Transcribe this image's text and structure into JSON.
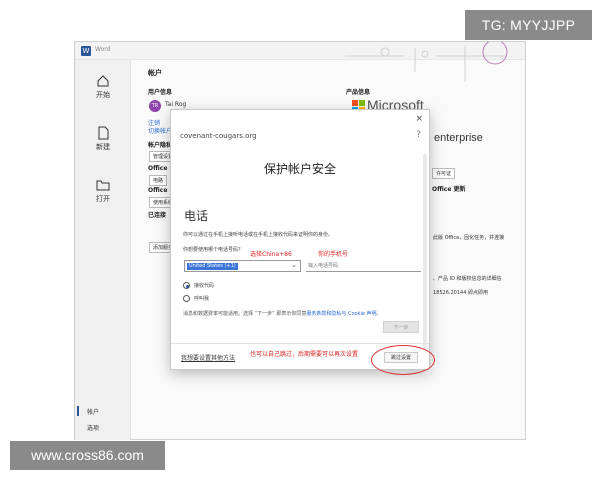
{
  "watermarks": {
    "top": "TG: MYYJJPP",
    "bottom": "www.cross86.com"
  },
  "app": {
    "title": "Word",
    "nav": [
      {
        "label": "开始",
        "icon": "home-icon"
      },
      {
        "label": "新建",
        "icon": "new-document-icon"
      },
      {
        "label": "打开",
        "icon": "folder-icon"
      }
    ],
    "bottom_nav": [
      "帐户",
      "选项"
    ],
    "page_title": "帐户",
    "user_info_heading": "用户信息",
    "user_name": "Tai Rog",
    "avatar_initials": "TR",
    "sign_out": "注销",
    "switch_account": "切换帐户",
    "account_privacy_heading": "帐户隐私",
    "manage_settings": "管理设置",
    "office_bg": "Office",
    "bg_value_1": "电路",
    "office_theme": "Office",
    "bg_value_2": "使用系统",
    "connected_services": "已连接",
    "add_service": "添加服务",
    "product_info_heading": "产品信息",
    "brand": "Microsoft",
    "enterprise": "enterprise",
    "license": "许可证",
    "office_update": "Office 更新",
    "product_text_1": "此版 Office，固化任务，并连接",
    "product_text_2": "、产品 ID 和版权信息的详细信",
    "product_text_3": "18526.20144 即点即用"
  },
  "dialog": {
    "close": "×",
    "domain": "covenant-cougars.org",
    "help": "?",
    "heading": "保护帐户安全",
    "section_title": "电话",
    "description": "你可以通过在手机上接听电话或在手机上接收代码来证明你的身份。",
    "question": "你想要使用哪个电话号码？",
    "country_value": "United States (+1)",
    "phone_placeholder": "输入电话号码",
    "radio_options": [
      {
        "label": "接收代码",
        "selected": true
      },
      {
        "label": "呼叫我",
        "selected": false
      }
    ],
    "fine_print_pre": "消息和数据费率可能适用。选择 “下一步” 即表示你同意",
    "fine_print_link": "服务条款和隐私与 Cookie 声明",
    "fine_print_post": "。",
    "next_button": "下一步",
    "other_method": "我想要设置其他方法",
    "skip_button": "跳过设置"
  },
  "annotations": {
    "choose_china": "选择China+86",
    "your_phone": "你的手机号",
    "skip_note": "也可以自己跳过，后期需要可以再次设置"
  },
  "colors": {
    "accent": "#2b579a",
    "annotation": "#dd2222",
    "link": "#2b6ad6"
  }
}
